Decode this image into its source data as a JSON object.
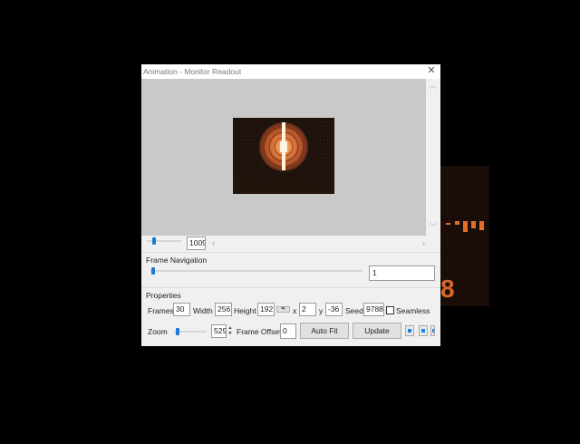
{
  "window": {
    "title": "Animation - Monitor Readout",
    "close_icon": "close-icon"
  },
  "preview": {
    "zoom_value": "1009"
  },
  "frame_navigation": {
    "heading": "Frame Navigation",
    "frame_value": "1"
  },
  "properties": {
    "heading": "Properties",
    "frames_label": "Frames",
    "frames_value": "30",
    "width_label": "Width",
    "width_value": "256",
    "height_label": "Height",
    "height_value": "192",
    "x_label": "x",
    "x_value": "2",
    "y_label": "y",
    "y_value": "-36",
    "seed_label": "Seed",
    "seed_value": "9788",
    "seamless_label": "Seamless",
    "zoom_label": "Zoom",
    "zoom_value": "529",
    "frame_offset_label": "Frame Offset",
    "frame_offset_value": "0",
    "auto_fit_label": "Auto Fit",
    "update_label": "Update"
  },
  "background_app": {
    "digit": "8"
  },
  "colors": {
    "accent": "#1e7ad7",
    "preview_bg": "#c9c9c9",
    "orange": "#e36e2a"
  }
}
